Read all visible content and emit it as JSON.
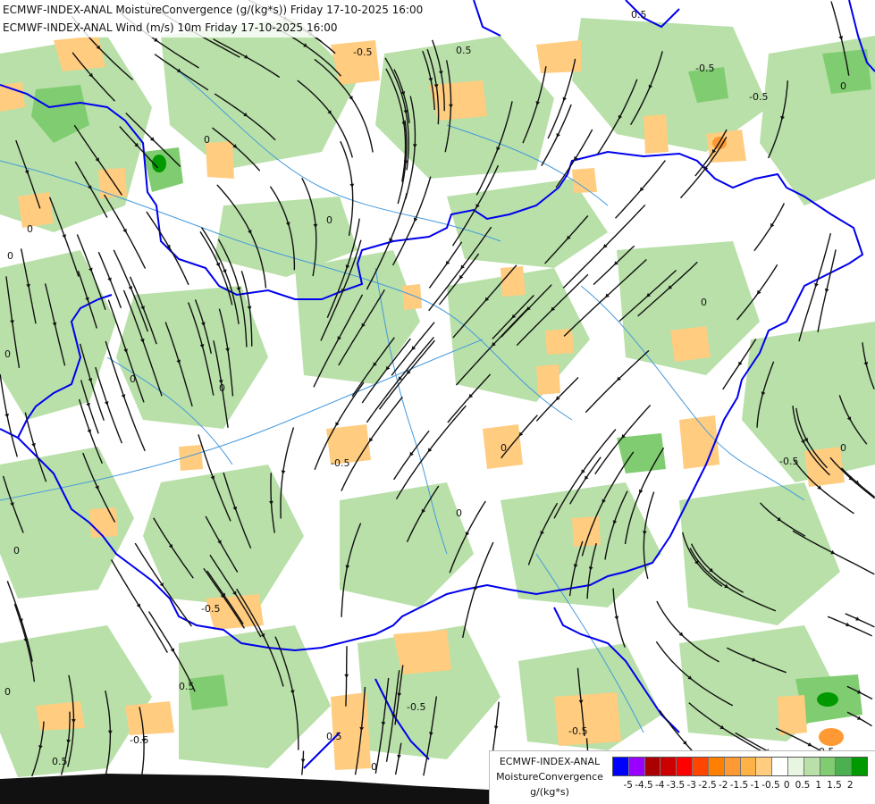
{
  "header": {
    "line1": "ECMWF-INDEX-ANAL MoistureConvergence (g/(kg*s)) Friday 17-10-2025 16:00",
    "line2": "ECMWF-INDEX-ANAL Wind (m/s) 10m Friday 17-10-2025 16:00"
  },
  "legend": {
    "title1": "ECMWF-INDEX-ANAL",
    "title2": "MoistureConvergence",
    "units": "g/(kg*s)",
    "colors": [
      "#0000ff",
      "#9900ff",
      "#aa0000",
      "#cc0000",
      "#ff0000",
      "#ff4500",
      "#ff7f00",
      "#ff9933",
      "#ffb347",
      "#ffcc80",
      "#ffffff",
      "#e8f5e0",
      "#b8e0a8",
      "#80cc70",
      "#4caf50",
      "#009900"
    ],
    "ticks": [
      "-5",
      "-4.5",
      "-4",
      "-3.5",
      "-3",
      "-2.5",
      "-2",
      "-1.5",
      "-1",
      "-0.5",
      "0",
      "0.5",
      "1",
      "1.5",
      "2"
    ]
  },
  "contour_labels": [
    "0.5",
    "-0.5",
    "0.5",
    "-0.5",
    "0",
    "0",
    "0",
    "0",
    "0",
    "0",
    "0",
    "0",
    "-0.5",
    "0",
    "0",
    "0",
    "0.5",
    "-0.5",
    "-0.5",
    "-0.5",
    "-0.5",
    "0",
    "0",
    "-0.5",
    "0.5",
    "0",
    "0",
    "-0.5",
    "0.5",
    "-0.5"
  ],
  "colors": {
    "border": "#0000ee",
    "rivers": "#4499dd",
    "streamline": "#111111",
    "convergence_green": "#b8e0a8",
    "divergence_orange": "#ffcc80",
    "strong_green": "#4caf50",
    "strong_orange": "#ff7f00"
  }
}
